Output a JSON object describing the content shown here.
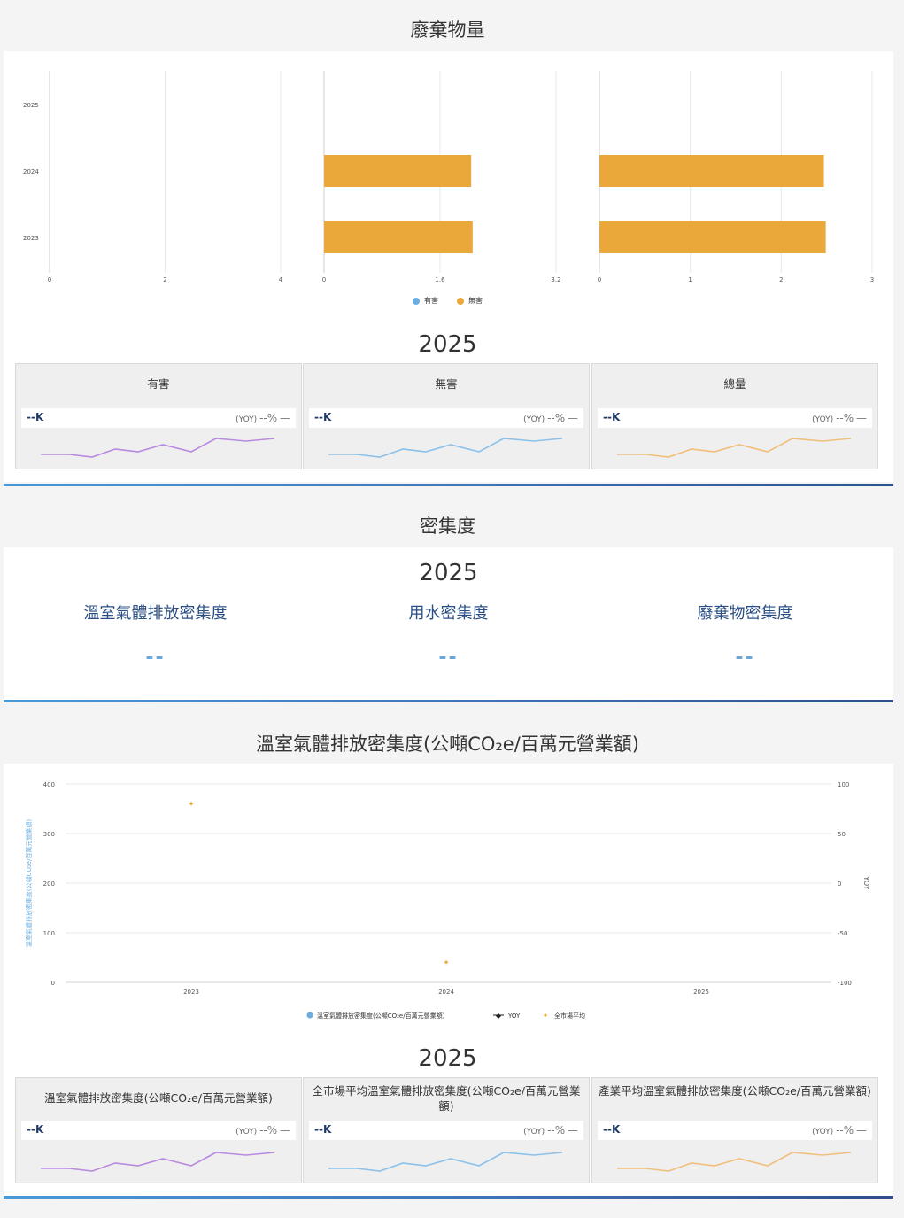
{
  "waste": {
    "title": "廢棄物量",
    "year": "2025",
    "cards": [
      {
        "title": "有害",
        "value": "--K",
        "yoy_label": "(YOY)",
        "yoy_value": "--%",
        "trend": "—"
      },
      {
        "title": "無害",
        "value": "--K",
        "yoy_label": "(YOY)",
        "yoy_value": "--%",
        "trend": "—"
      },
      {
        "title": "總量",
        "value": "--K",
        "yoy_label": "(YOY)",
        "yoy_value": "--%",
        "trend": "—"
      }
    ]
  },
  "density": {
    "title": "密集度",
    "year": "2025",
    "items": [
      {
        "label": "溫室氣體排放密集度",
        "value": "--"
      },
      {
        "label": "用水密集度",
        "value": "--"
      },
      {
        "label": "廢棄物密集度",
        "value": "--"
      }
    ]
  },
  "ghg": {
    "title": "溫室氣體排放密集度(公噸CO₂e/百萬元營業額)",
    "year": "2025",
    "cards": [
      {
        "title": "溫室氣體排放密集度(公噸CO₂e/百萬元營業額)",
        "value": "--K",
        "yoy_label": "(YOY)",
        "yoy_value": "--%",
        "trend": "—"
      },
      {
        "title": "全市場平均溫室氣體排放密集度(公噸CO₂e/百萬元營業額)",
        "value": "--K",
        "yoy_label": "(YOY)",
        "yoy_value": "--%",
        "trend": "—"
      },
      {
        "title": "產業平均溫室氣體排放密集度(公噸CO₂e/百萬元營業額)",
        "value": "--K",
        "yoy_label": "(YOY)",
        "yoy_value": "--%",
        "trend": "—"
      }
    ]
  },
  "colors": {
    "hazardous": "#6aaee0",
    "non_hazardous": "#eba83a",
    "spark_purple": "#b98ae0",
    "spark_blue": "#8cc1ea",
    "spark_orange": "#f0bf7c",
    "market_avg": "#eba83a",
    "yoy": "#222222"
  },
  "chart_data": [
    {
      "type": "bar",
      "orientation": "horizontal",
      "categories": [
        "2025",
        "2024",
        "2023"
      ],
      "series": [
        {
          "name": "有害",
          "values": [
            null,
            null,
            null
          ]
        }
      ],
      "xlim": [
        0,
        4
      ],
      "xticks": [
        "0",
        "2",
        "4"
      ],
      "legend": "bottom"
    },
    {
      "type": "bar",
      "orientation": "horizontal",
      "categories": [
        "2025",
        "2024",
        "2023"
      ],
      "series": [
        {
          "name": "無害",
          "values": [
            null,
            2.03,
            2.05
          ]
        }
      ],
      "xlim": [
        0,
        3.2
      ],
      "xticks": [
        "0",
        "1.6",
        "3.2"
      ],
      "legend": "bottom"
    },
    {
      "type": "bar",
      "orientation": "horizontal",
      "categories": [
        "2025",
        "2024",
        "2023"
      ],
      "series": [
        {
          "name": "總量",
          "values": [
            null,
            2.47,
            2.49
          ]
        }
      ],
      "xlim": [
        0,
        3
      ],
      "xticks": [
        "0",
        "1",
        "2",
        "3"
      ],
      "legend": "bottom"
    },
    {
      "type": "line",
      "x": [
        "2023",
        "2024",
        "2025"
      ],
      "ylabel": "溫室氣體排放密集度(公噸CO₂e/百萬元營業額)",
      "y2label": "YOY",
      "ylim": [
        0,
        400
      ],
      "y2lim": [
        -100,
        100
      ],
      "yticks": [
        "400",
        "300",
        "200",
        "100",
        "0"
      ],
      "y2ticks": [
        "100",
        "50",
        "0",
        "-50",
        "-100"
      ],
      "series": [
        {
          "name": "溫室氣體排放密集度(公噸CO₂e/百萬元營業額)",
          "values": [
            null,
            null,
            null
          ]
        },
        {
          "name": "YOY",
          "axis": "right",
          "values": [
            null,
            null,
            null
          ]
        },
        {
          "name": "全市場平均",
          "values": [
            360,
            40,
            null
          ]
        }
      ],
      "legend": "bottom"
    }
  ]
}
